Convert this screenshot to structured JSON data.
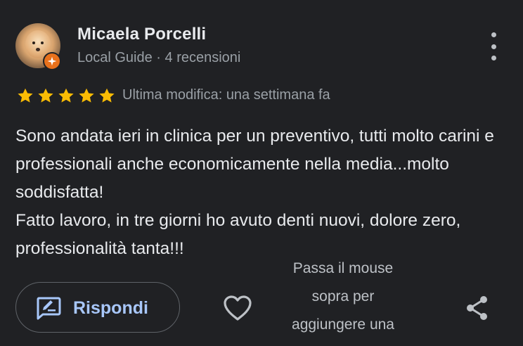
{
  "reviewer": {
    "name": "Micaela Porcelli",
    "meta": "Local Guide · 4 recensioni"
  },
  "rating": {
    "stars": 5,
    "max": 5,
    "modified": "Ultima modifica: una settimana fa"
  },
  "review": {
    "lines": [
      "Sono andata ieri in clinica per un preventivo, tutti molto carini e professionali anche economicamente nella media...molto soddisfatta!",
      "Fatto lavoro, in tre giorni ho avuto denti nuovi, dolore zero, professionalità tanta!!!"
    ]
  },
  "actions": {
    "reply_label": "Rispondi",
    "tooltip": "Passa il mouse sopra per aggiungere una"
  },
  "icons": {
    "more": "more-vert-icon",
    "reply": "reply-edit-icon",
    "like": "heart-outline-icon",
    "share": "share-icon",
    "badge": "local-guide-star-icon"
  },
  "colors": {
    "background": "#202124",
    "star": "#fbbc04",
    "reply_accent": "#a8c7fa",
    "badge": "#e8711c",
    "secondary_text": "#9aa0a6"
  }
}
